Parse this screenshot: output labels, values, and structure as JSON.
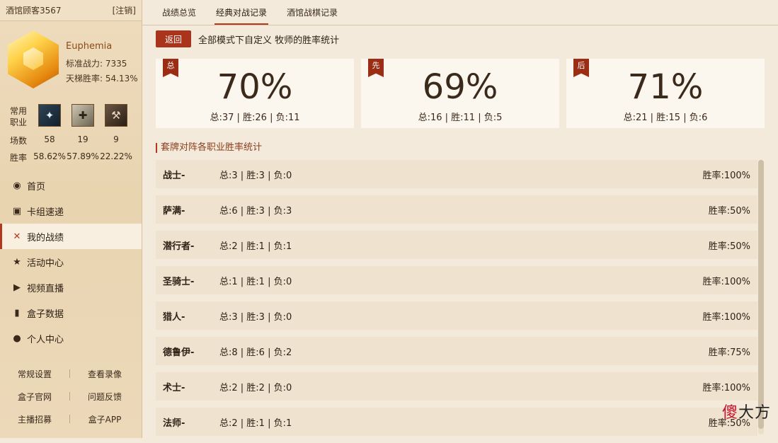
{
  "top": {
    "username": "酒馆顾客3567",
    "logout": "[注销]"
  },
  "profile": {
    "name": "Euphemia",
    "power": "标准战力: 7335",
    "ladder_rate": "天梯胜率: 54.13%"
  },
  "common_classes": {
    "label": "常用职业",
    "icons": [
      "mage-icon",
      "priest-icon",
      "warrior-icon"
    ],
    "games_label": "场数",
    "games": [
      "58",
      "19",
      "9"
    ],
    "rate_label": "胜率",
    "rates": [
      "58.62%",
      "57.89%",
      "22.22%"
    ]
  },
  "nav": [
    {
      "label": "首页",
      "icon": "home-icon",
      "glyph": "◉"
    },
    {
      "label": "卡组速递",
      "icon": "deck-icon",
      "glyph": "▣"
    },
    {
      "label": "我的战绩",
      "icon": "crossed-swords-icon",
      "glyph": "✕"
    },
    {
      "label": "活动中心",
      "icon": "star-icon",
      "glyph": "★"
    },
    {
      "label": "视频直播",
      "icon": "video-icon",
      "glyph": "▶"
    },
    {
      "label": "盒子数据",
      "icon": "bar-chart-icon",
      "glyph": "▮"
    },
    {
      "label": "个人中心",
      "icon": "user-icon",
      "glyph": "●"
    }
  ],
  "footer_links": [
    [
      "常规设置",
      "查看录像"
    ],
    [
      "盒子官网",
      "问题反馈"
    ],
    [
      "主播招募",
      "盒子APP"
    ]
  ],
  "tabs": [
    "战绩总览",
    "经典对战记录",
    "酒馆战棋记录"
  ],
  "back_label": "返回",
  "crumb": "全部模式下自定义 牧师的胜率统计",
  "cards": [
    {
      "flag": "总",
      "pct": "70%",
      "line": "总:37 | 胜:26 | 负:11"
    },
    {
      "flag": "先",
      "pct": "69%",
      "line": "总:16 | 胜:11 | 负:5"
    },
    {
      "flag": "后",
      "pct": "71%",
      "line": "总:21 | 胜:15 | 负:6"
    }
  ],
  "section_title": "套牌对阵各职业胜率统计",
  "rows": [
    {
      "name": "战士-",
      "stats": "总:3 | 胜:3 | 负:0",
      "rate": "胜率:100%"
    },
    {
      "name": "萨满-",
      "stats": "总:6 | 胜:3 | 负:3",
      "rate": "胜率:50%"
    },
    {
      "name": "潜行者-",
      "stats": "总:2 | 胜:1 | 负:1",
      "rate": "胜率:50%"
    },
    {
      "name": "圣骑士-",
      "stats": "总:1 | 胜:1 | 负:0",
      "rate": "胜率:100%"
    },
    {
      "name": "猎人-",
      "stats": "总:3 | 胜:3 | 负:0",
      "rate": "胜率:100%"
    },
    {
      "name": "德鲁伊-",
      "stats": "总:8 | 胜:6 | 负:2",
      "rate": "胜率:75%"
    },
    {
      "name": "术士-",
      "stats": "总:2 | 胜:2 | 负:0",
      "rate": "胜率:100%"
    },
    {
      "name": "法师-",
      "stats": "总:2 | 胜:1 | 负:1",
      "rate": "胜率:50%"
    }
  ],
  "watermark": {
    "a": "傻",
    "b": "大方"
  },
  "colors": {
    "accent": "#b13a1e",
    "card_bg": "#fbf6ee",
    "row_bg": "#efe3cf"
  }
}
